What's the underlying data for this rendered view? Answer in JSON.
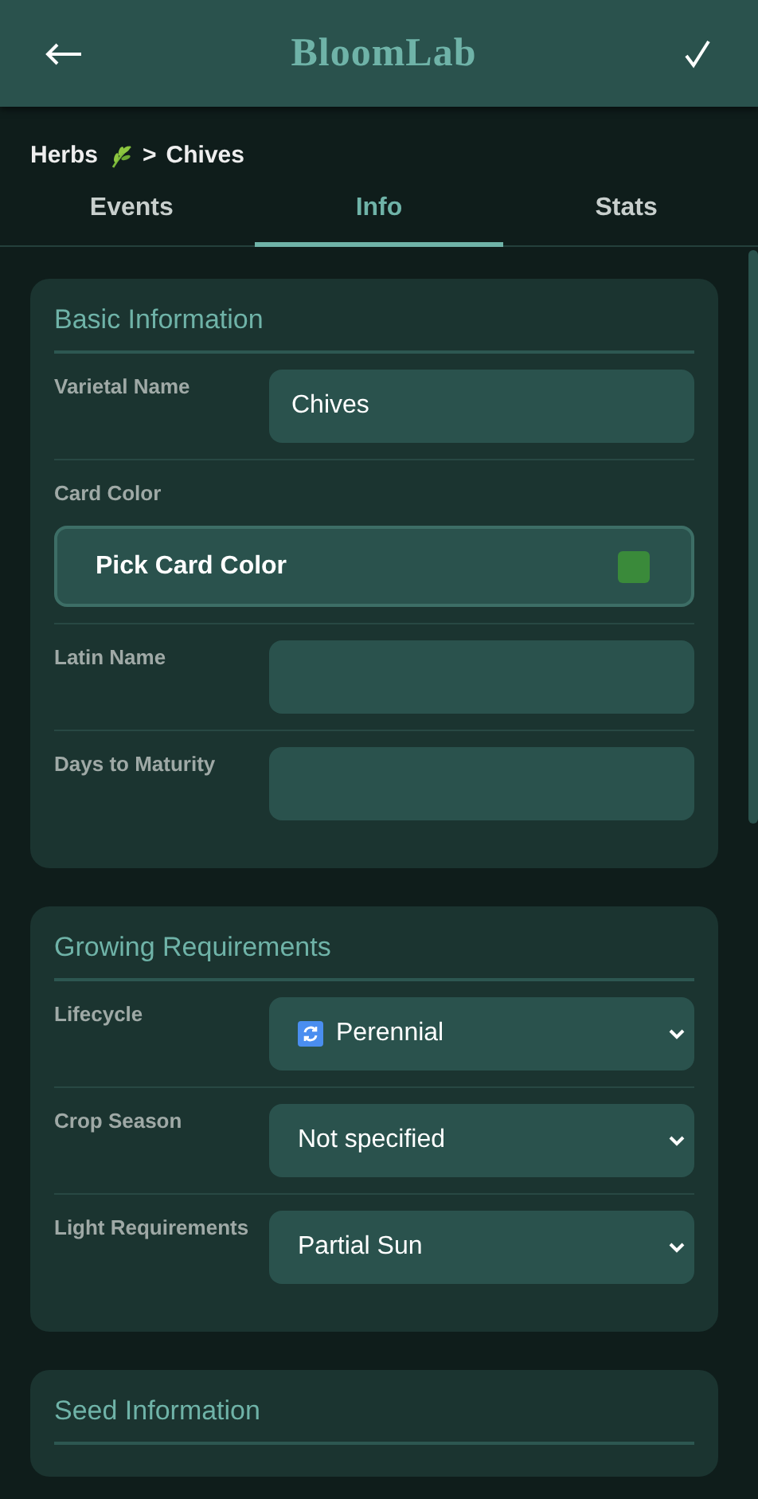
{
  "header": {
    "title": "BloomLab"
  },
  "breadcrumb": {
    "category": "Herbs",
    "separator": ">",
    "item": "Chives"
  },
  "tabs": [
    {
      "label": "Events",
      "selected": false
    },
    {
      "label": "Info",
      "selected": true
    },
    {
      "label": "Stats",
      "selected": false
    }
  ],
  "sections": [
    {
      "title": "Basic Information",
      "fields": [
        {
          "kind": "text",
          "label": "Varietal Name",
          "value": "Chives"
        },
        {
          "kind": "color",
          "label": "Card Color",
          "button": "Pick Card Color",
          "color": "#3a8a3a"
        },
        {
          "kind": "text",
          "label": "Latin Name"
        },
        {
          "kind": "text",
          "label": "Days to Maturity"
        }
      ]
    },
    {
      "title": "Growing Requirements",
      "fields": [
        {
          "kind": "select",
          "label": "Lifecycle",
          "value": "Perennial",
          "has_icon": true
        },
        {
          "kind": "select",
          "label": "Crop Season",
          "value": "Not specified"
        },
        {
          "kind": "select",
          "label": "Light Requirements",
          "value": "Partial Sun"
        }
      ]
    },
    {
      "title": "Seed Information"
    }
  ]
}
